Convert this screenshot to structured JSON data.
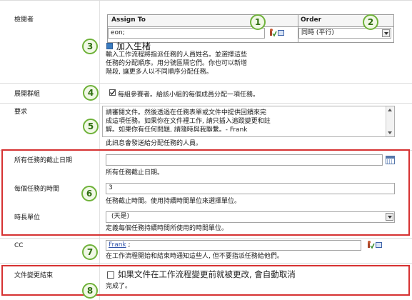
{
  "callouts": [
    "1",
    "2",
    "3",
    "4",
    "5",
    "6",
    "7",
    "8"
  ],
  "approvers": {
    "label": "檢閱者",
    "assign_to_header": "Assign To",
    "order_header": "Order",
    "assignee_value": "eon;",
    "order_value": "同時 (平行)",
    "add_stage": "加入生楮",
    "description": [
      "輸入工作流程將指派任務的人員姓名。並選擇這些",
      "任務的分配順序。用分號區隔它們。你也可以新增",
      "階段, 讓更多人以不同順序分配任務。"
    ]
  },
  "expand_groups": {
    "label": "展開群組",
    "checkbox_label": "每組參賽者。給該小組的每個成員分配一項任務。",
    "checked": true
  },
  "request": {
    "label": "要求",
    "text_lines": [
      "請審閱文件。然後透過在任務表單或文件中提供回饋來完",
      "成這項任務。如果你在文件裡工作, 請只插入追蹤變更和註",
      "解。如果你有任何問題, 請隨時與我聯繫。- Frank"
    ],
    "description": "此訊息會發送給分配任務的人員。"
  },
  "due_date_all": {
    "label": "所有任務的截止日期",
    "value": "",
    "description": "所有任務截止日期。"
  },
  "duration_per_task": {
    "label": "每個任務的時間",
    "value": "3",
    "description": "任務截止時間。使用持續時間單位來選擇單位。"
  },
  "duration_units": {
    "label": "時長單位",
    "value": "(天是)",
    "description": "定義每個任務持續時間所使用的時間單位。"
  },
  "cc": {
    "label": "CC",
    "value": "Frank",
    "value_suffix": " ;",
    "description": "在工作流程開始和結束時通知這些人, 但不要指派任務給他們。"
  },
  "end_on_change": {
    "label": "文件變更結束",
    "checkbox_label": "如果文件在工作流程變更前就被更改, 會自動取消",
    "checkbox_label_line2": "完成了。",
    "checked": false
  },
  "colors": {
    "callout_border": "#6fb23a",
    "highlight_border": "#d63232",
    "link": "#3355aa"
  }
}
